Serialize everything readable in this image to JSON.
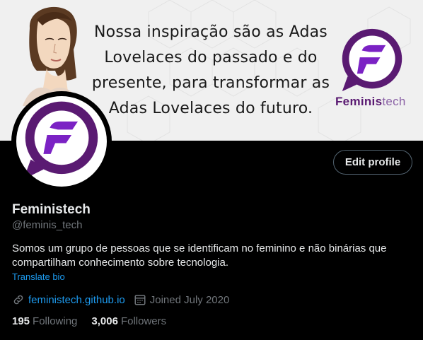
{
  "banner": {
    "quote_lines": [
      "Nossa inspiração são as Adas",
      "Lovelaces do passado e do",
      "presente, para transformar as",
      "Adas Lovelaces do futuro."
    ],
    "brand_part1": "Feminis",
    "brand_part2": "tech",
    "brand_colors": {
      "primary": "#5a1a72",
      "accent": "#8b2fc9"
    }
  },
  "profile": {
    "name": "Feministech",
    "handle": "@feminis_tech",
    "bio": "Somos um grupo de pessoas que se identificam no feminino e não binárias que compartilham conhecimento sobre tecnologia.",
    "translate_label": "Translate bio",
    "website": "feministech.github.io",
    "joined": "Joined July 2020",
    "edit_label": "Edit profile"
  },
  "stats": {
    "following_count": "195",
    "following_label": "Following",
    "followers_count": "3,006",
    "followers_label": "Followers"
  },
  "icons": {
    "link": "link-icon",
    "calendar": "calendar-icon",
    "logo": "feministech-logo-icon"
  }
}
